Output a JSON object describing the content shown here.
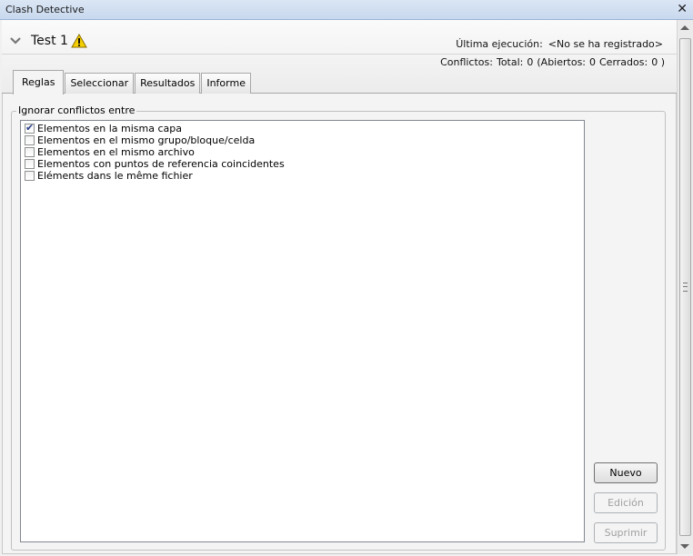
{
  "window": {
    "title": "Clash Detective",
    "close_glyph": "✕"
  },
  "test": {
    "name": "Test 1",
    "last_run_label": "Última ejecución:",
    "last_run_value": "<No se ha registrado>",
    "conflicts_label": "Conflictos:",
    "total_label": "Total:",
    "total_value": "0",
    "open_label": "(Abiertos:",
    "open_value": "0",
    "closed_label": "Cerrados:",
    "closed_value": "0 )"
  },
  "tabs": [
    {
      "label": "Reglas",
      "active": true
    },
    {
      "label": "Seleccionar",
      "active": false
    },
    {
      "label": "Resultados",
      "active": false
    },
    {
      "label": "Informe",
      "active": false
    }
  ],
  "rules": {
    "group_label": "Ignorar conflictos entre",
    "items": [
      {
        "label": "Elementos en la misma capa",
        "checked": true
      },
      {
        "label": "Elementos en el mismo grupo/bloque/celda",
        "checked": false
      },
      {
        "label": "Elementos en el mismo archivo",
        "checked": false
      },
      {
        "label": "Elementos con puntos de referencia coincidentes",
        "checked": false
      },
      {
        "label": "Eléments dans le même fichier",
        "checked": false
      }
    ]
  },
  "buttons": {
    "new": "Nuevo",
    "edit": "Edición",
    "delete": "Suprimir"
  },
  "colors": {
    "title_bar": "#c8d8ee",
    "warning": "#f5d000",
    "check": "#2a3f8c"
  }
}
